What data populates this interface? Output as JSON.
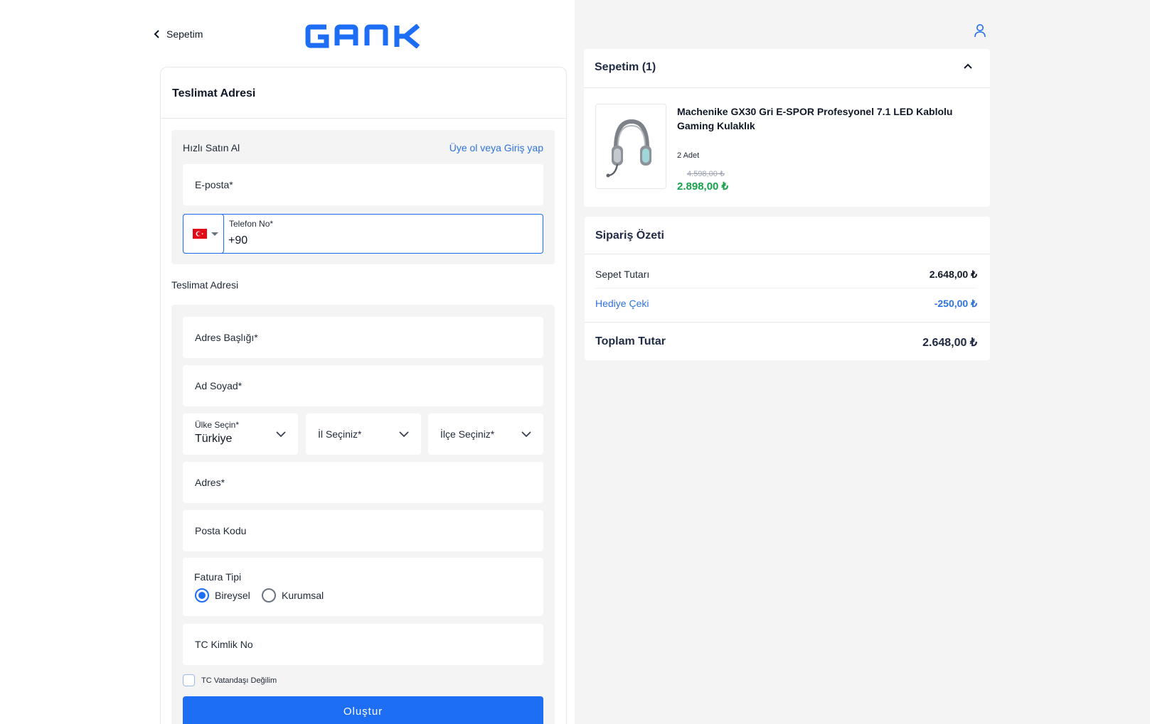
{
  "header": {
    "back_label": "Sepetim",
    "logo_text": "GANK"
  },
  "form": {
    "card_title": "Teslimat Adresi",
    "quick_buy": {
      "title": "Hızlı Satın Al",
      "login_link": "Üye ol veya Giriş yap",
      "email_label": "E-posta*",
      "phone_label": "Telefon No*",
      "phone_value": "+90",
      "country_flag": "tr-flag"
    },
    "address_section_title": "Teslimat Adresi",
    "fields": {
      "address_title": "Adres Başlığı*",
      "full_name": "Ad Soyad*",
      "country_label": "Ülke Seçin*",
      "country_value": "Türkiye",
      "city": "İl Seçiniz*",
      "district": "İlçe Seçiniz*",
      "address": "Adres*",
      "postal_code": "Posta Kodu",
      "tc_id": "TC Kimlik No"
    },
    "invoice": {
      "title": "Fatura Tipi",
      "options": [
        "Bireysel",
        "Kurumsal"
      ],
      "selected": "Bireysel"
    },
    "not_citizen_label": "TC Vatandaşı Değilim",
    "submit_label": "Oluştur"
  },
  "cart": {
    "title": "Sepetim (1)",
    "items": [
      {
        "name": "Machenike GX30 Gri E-SPOR Profesyonel 7.1 LED Kablolu Gaming Kulaklık",
        "quantity": "2 Adet",
        "old_price": "4.598,00 ₺",
        "price": "2.898,00 ₺"
      }
    ]
  },
  "summary": {
    "title": "Sipariş Özeti",
    "subtotal_label": "Sepet Tutarı",
    "subtotal_value": "2.648,00 ₺",
    "gift_label": "Hediye Çeki",
    "gift_value": "-250,00 ₺",
    "total_label": "Toplam Tutar",
    "total_value": "2.648,00 ₺"
  },
  "colors": {
    "accent": "#1d6ef5",
    "price_green": "#16a34a",
    "panel_bg": "#f4f4f4"
  }
}
